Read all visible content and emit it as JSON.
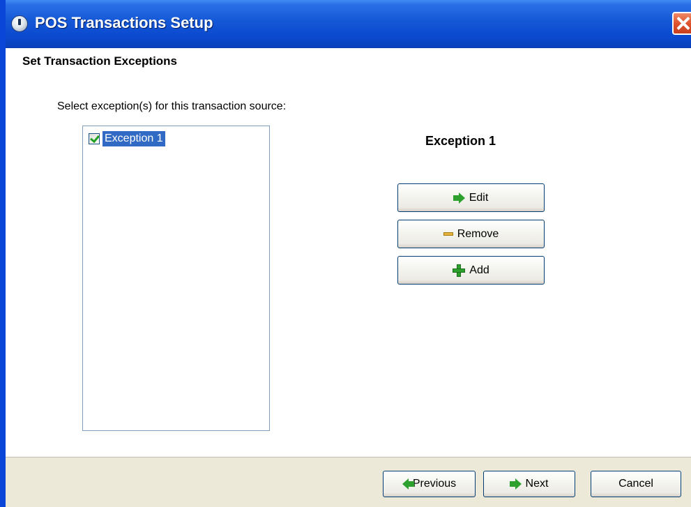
{
  "window": {
    "title": "POS Transactions Setup"
  },
  "page": {
    "heading": "Set Transaction Exceptions",
    "instruction": "Select exception(s) for this transaction source:"
  },
  "exceptions_list": {
    "items": [
      {
        "label": "Exception 1",
        "checked": true,
        "selected": true
      }
    ]
  },
  "detail": {
    "title": "Exception 1",
    "edit_label": "Edit",
    "remove_label": "Remove",
    "add_label": "Add"
  },
  "footer": {
    "previous_label": "Previous",
    "next_label": "Next",
    "cancel_label": "Cancel"
  },
  "colors": {
    "titlebar": "#0a4ad0",
    "selection": "#316ac5",
    "footer": "#ece9d8",
    "icon_green": "#2da02d",
    "icon_minus": "#e6b43c"
  },
  "icons": {
    "title": "app-icon",
    "close": "close-icon",
    "edit": "arrow-right-icon",
    "remove": "minus-icon",
    "add": "plus-icon",
    "previous": "arrow-left-icon",
    "next": "arrow-right-icon"
  }
}
